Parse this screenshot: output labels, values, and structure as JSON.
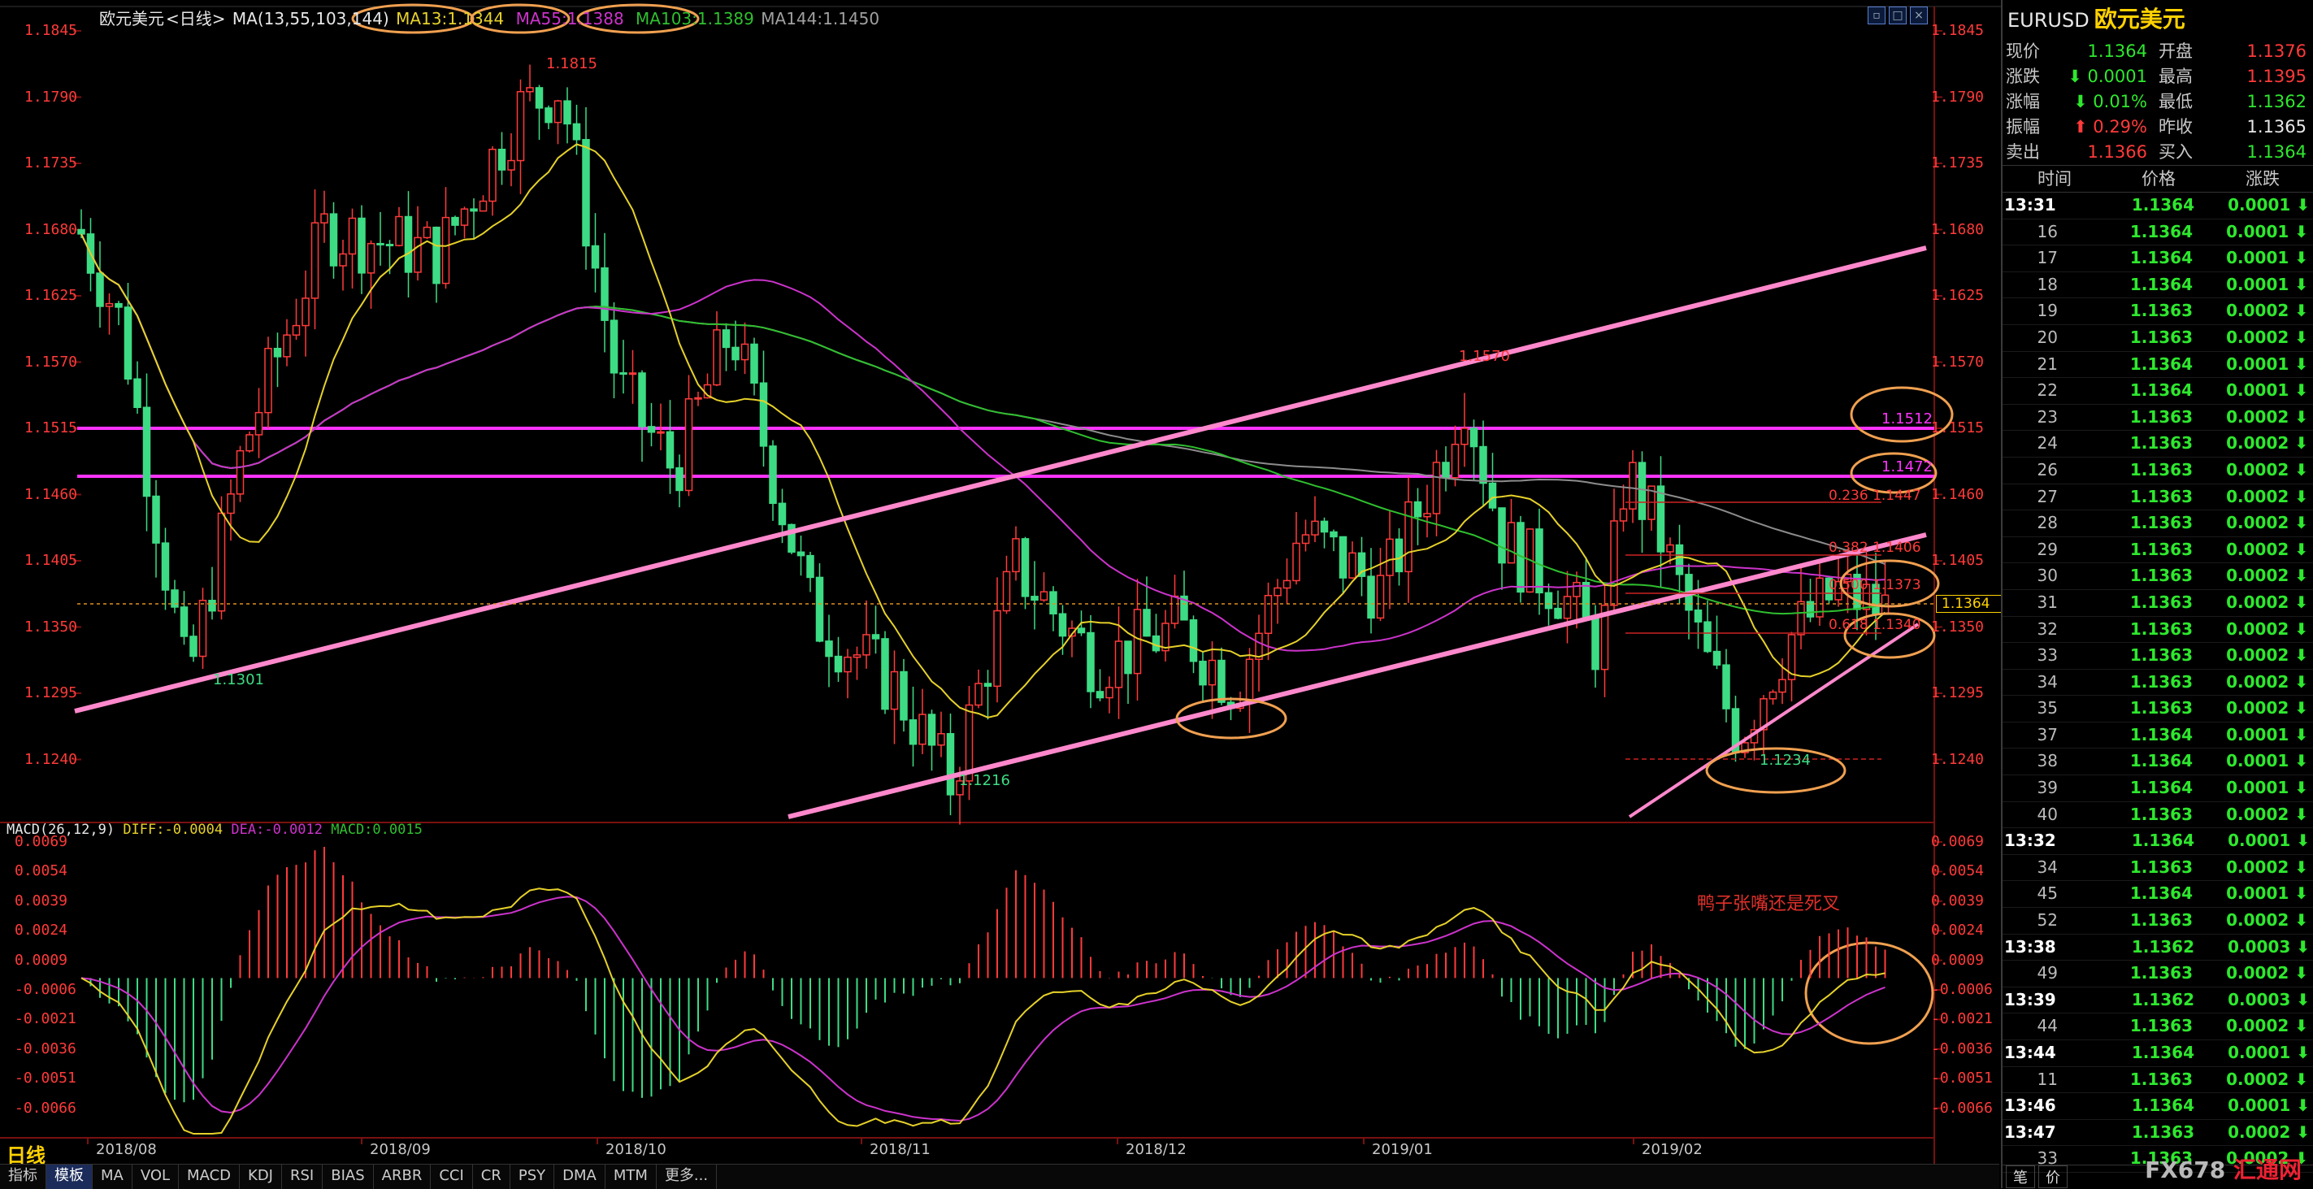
{
  "header": {
    "instrument": "欧元美元",
    "period": "<日线>",
    "ma_label": "MA(13,55,103,144)",
    "ma13": "MA13:1.1344",
    "ma55": "MA55:1.1388",
    "ma103": "MA103:1.1389",
    "ma144": "MA144:1.1450"
  },
  "colors": {
    "up": "#ff3a3a",
    "down": "#3ddc84",
    "ma13": "#e6d12a",
    "ma55": "#cc33cc",
    "ma103": "#2fbf2f",
    "ma144": "#8c8c8c",
    "channel": "#ff88cc",
    "hline": "#ff33ff",
    "circle": "#f0a050",
    "annotation": "#e0302a"
  },
  "price_axis": [
    "1.1845",
    "1.1790",
    "1.1735",
    "1.1680",
    "1.1625",
    "1.1570",
    "1.1515",
    "1.1460",
    "1.1405",
    "1.1350",
    "1.1295",
    "1.1240"
  ],
  "macd_axis": [
    "0.0069",
    "0.0054",
    "0.0039",
    "0.0024",
    "0.0009",
    "-0.0006",
    "-0.0021",
    "-0.0036",
    "-0.0051",
    "-0.0066"
  ],
  "date_axis": [
    "2018/08",
    "2018/09",
    "2018/10",
    "2018/11",
    "2018/12",
    "2019/01",
    "2019/02"
  ],
  "price_labels": {
    "high": "1.1815",
    "low_aug": "1.1301",
    "low_nov": "1.1216",
    "high_jan": "1.1570",
    "low_feb": "1.1234",
    "h1": "1.1512",
    "h2": "1.1472",
    "fib236": "0.236 1.1447",
    "fib382": "0.382 1.1406",
    "fib500": "0.500 1.1373",
    "fib618": "0.618 1.1340",
    "current": "1.1364"
  },
  "macd_header": {
    "label": "MACD(26,12,9)",
    "diff": "DIFF:-0.0004",
    "dea": "DEA:-0.0012",
    "macd": "MACD:0.0015"
  },
  "annotation_text": "鸭子张嘴还是死叉",
  "period_label": "日线",
  "bottom_tabs": [
    "指标",
    "模板",
    "MA",
    "VOL",
    "MACD",
    "KDJ",
    "RSI",
    "BIAS",
    "ARBR",
    "CCI",
    "CR",
    "PSY",
    "DMA",
    "MTM",
    "更多..."
  ],
  "right_panel": {
    "symbol": "EURUSD",
    "name": "欧元美元",
    "quotes": [
      {
        "k1": "现价",
        "v1": "1.1364",
        "c1": "#2ee82e",
        "k2": "开盘",
        "v2": "1.1376",
        "c2": "#ff3a3a"
      },
      {
        "k1": "涨跌",
        "v1": "0.0001",
        "c1": "#2ee82e",
        "a1": "down",
        "k2": "最高",
        "v2": "1.1395",
        "c2": "#ff3a3a"
      },
      {
        "k1": "涨幅",
        "v1": "0.01%",
        "c1": "#2ee82e",
        "a1": "down",
        "k2": "最低",
        "v2": "1.1362",
        "c2": "#2ee82e"
      },
      {
        "k1": "振幅",
        "v1": "0.29%",
        "c1": "#ff3a3a",
        "a1": "up",
        "k2": "昨收",
        "v2": "1.1365",
        "c2": "#e8e8e8"
      },
      {
        "k1": "卖出",
        "v1": "1.1366",
        "c1": "#ff3a3a",
        "k2": "买入",
        "v2": "1.1364",
        "c2": "#2ee82e"
      }
    ],
    "tick_header": [
      "时间",
      "价格",
      "涨跌"
    ],
    "ticks": [
      {
        "t": "13:31",
        "p": "1.1364",
        "c": "0.0001",
        "minute": true
      },
      {
        "t": "16",
        "p": "1.1364",
        "c": "0.0001"
      },
      {
        "t": "17",
        "p": "1.1364",
        "c": "0.0001"
      },
      {
        "t": "18",
        "p": "1.1364",
        "c": "0.0001"
      },
      {
        "t": "19",
        "p": "1.1363",
        "c": "0.0002"
      },
      {
        "t": "20",
        "p": "1.1363",
        "c": "0.0002"
      },
      {
        "t": "21",
        "p": "1.1364",
        "c": "0.0001"
      },
      {
        "t": "22",
        "p": "1.1364",
        "c": "0.0001"
      },
      {
        "t": "23",
        "p": "1.1363",
        "c": "0.0002"
      },
      {
        "t": "24",
        "p": "1.1363",
        "c": "0.0002"
      },
      {
        "t": "26",
        "p": "1.1363",
        "c": "0.0002"
      },
      {
        "t": "27",
        "p": "1.1363",
        "c": "0.0002"
      },
      {
        "t": "28",
        "p": "1.1363",
        "c": "0.0002"
      },
      {
        "t": "29",
        "p": "1.1363",
        "c": "0.0002"
      },
      {
        "t": "30",
        "p": "1.1363",
        "c": "0.0002"
      },
      {
        "t": "31",
        "p": "1.1363",
        "c": "0.0002"
      },
      {
        "t": "32",
        "p": "1.1363",
        "c": "0.0002"
      },
      {
        "t": "33",
        "p": "1.1363",
        "c": "0.0002"
      },
      {
        "t": "34",
        "p": "1.1363",
        "c": "0.0002"
      },
      {
        "t": "35",
        "p": "1.1363",
        "c": "0.0002"
      },
      {
        "t": "37",
        "p": "1.1364",
        "c": "0.0001"
      },
      {
        "t": "38",
        "p": "1.1364",
        "c": "0.0001"
      },
      {
        "t": "39",
        "p": "1.1364",
        "c": "0.0001"
      },
      {
        "t": "40",
        "p": "1.1363",
        "c": "0.0002"
      },
      {
        "t": "13:32",
        "p": "1.1364",
        "c": "0.0001",
        "minute": true
      },
      {
        "t": "34",
        "p": "1.1363",
        "c": "0.0002"
      },
      {
        "t": "45",
        "p": "1.1364",
        "c": "0.0001"
      },
      {
        "t": "52",
        "p": "1.1363",
        "c": "0.0002"
      },
      {
        "t": "13:38",
        "p": "1.1362",
        "c": "0.0003",
        "minute": true
      },
      {
        "t": "49",
        "p": "1.1363",
        "c": "0.0002"
      },
      {
        "t": "13:39",
        "p": "1.1362",
        "c": "0.0003",
        "minute": true
      },
      {
        "t": "44",
        "p": "1.1363",
        "c": "0.0002"
      },
      {
        "t": "13:44",
        "p": "1.1364",
        "c": "0.0001",
        "minute": true
      },
      {
        "t": "11",
        "p": "1.1363",
        "c": "0.0002"
      },
      {
        "t": "13:46",
        "p": "1.1364",
        "c": "0.0001",
        "minute": true
      },
      {
        "t": "13:47",
        "p": "1.1363",
        "c": "0.0002",
        "minute": true
      },
      {
        "t": "33",
        "p": "1.1363",
        "c": "0.0002"
      }
    ],
    "bottom_buttons": [
      "笔",
      "价"
    ],
    "watermark_a": "FX678",
    "watermark_b": "汇通网"
  }
}
